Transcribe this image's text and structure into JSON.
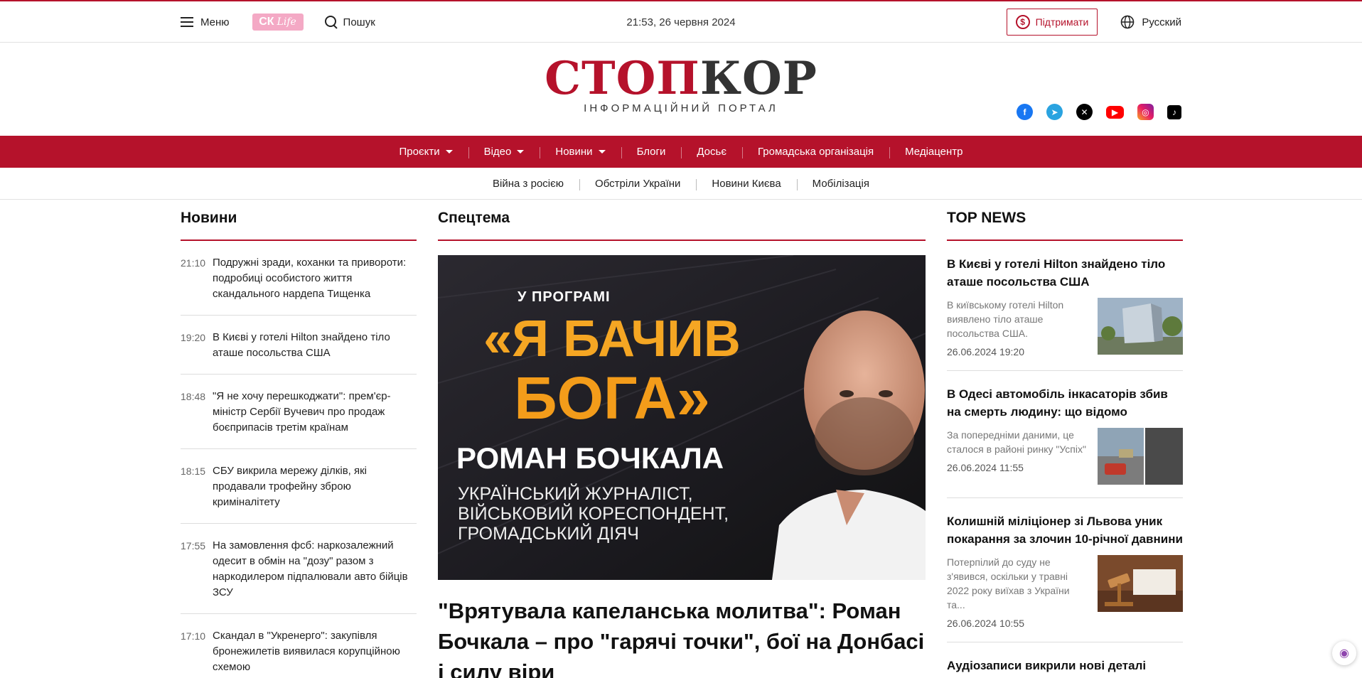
{
  "topbar": {
    "menu_label": "Меню",
    "cklife_main": "СК",
    "cklife_sub": "Life",
    "search_label": "Пошук",
    "datetime": "21:53, 26 червня 2024",
    "support_label": "Підтримати",
    "support_icon": "$",
    "language_label": "Русский"
  },
  "brand": {
    "logo_red": "СТОП",
    "logo_dark": "КОР",
    "tagline": "ІНФОРМАЦІЙНИЙ ПОРТАЛ"
  },
  "socials": [
    "facebook-icon",
    "telegram-icon",
    "x-icon",
    "youtube-icon",
    "instagram-icon",
    "tiktok-icon"
  ],
  "main_nav": [
    {
      "label": "Проєкти",
      "dropdown": true
    },
    {
      "label": "Відео",
      "dropdown": true
    },
    {
      "label": "Новини",
      "dropdown": true
    },
    {
      "label": "Блоги",
      "dropdown": false
    },
    {
      "label": "Досьє",
      "dropdown": false
    },
    {
      "label": "Громадська організація",
      "dropdown": false
    },
    {
      "label": "Медіацентр",
      "dropdown": false
    }
  ],
  "sub_nav": [
    "Війна з росією",
    "Обстріли України",
    "Новини Києва",
    "Мобілізація"
  ],
  "news": {
    "title": "Новини",
    "items": [
      {
        "time": "21:10",
        "headline": "Подружні зради, коханки та привороти: подробиці особистого життя скандального нардепа Тищенка"
      },
      {
        "time": "19:20",
        "headline": "В Києві у готелі Hilton знайдено тіло аташе посольства США"
      },
      {
        "time": "18:48",
        "headline": "\"Я не хочу перешкоджати\": прем'єр-міністр Сербії Вучевич про продаж боєприпасів третім країнам"
      },
      {
        "time": "18:15",
        "headline": "СБУ викрила мережу ділків, які продавали трофейну зброю криміналітету"
      },
      {
        "time": "17:55",
        "headline": "На замовлення фсб: наркозалежний одесит в обмін на \"дозу\" разом з наркодилером підпалювали авто бійців ЗСУ"
      },
      {
        "time": "17:10",
        "headline": "Скандал в \"Укренерго\": закупівля бронежилетів виявилася корупційною схемою"
      }
    ]
  },
  "special": {
    "title": "Спецтема",
    "hero_line1": "У ПРОГРАМІ",
    "hero_line2": "«Я БАЧИВ",
    "hero_line3": "БОГА»",
    "hero_line4": "РОМАН БОЧКАЛА",
    "hero_line5": "УКРАЇНСЬКИЙ ЖУРНАЛІСТ, ВІЙСЬКОВИЙ КОРЕСПОНДЕНТ, ГРОМАДСЬКИЙ ДІЯЧ",
    "headline": "\"Врятувала капеланська молитва\": Роман Бочкала – про \"гарячі точки\", бої на Донбасі і силу віри"
  },
  "top_news": {
    "title": "TOP NEWS",
    "items": [
      {
        "headline": "В Києві у готелі Hilton знайдено тіло аташе посольства США",
        "lead": "В київському готелі Hilton виявлено тіло аташе посольства США.",
        "date": "26.06.2024 19:20"
      },
      {
        "headline": "В Одесі автомобіль інкасаторів збив на смерть людину: що відомо",
        "lead": "За попередніми даними, це сталося в районі ринку \"Успіх\"",
        "date": "26.06.2024 11:55"
      },
      {
        "headline": "Колишній міліціонер зі Львова уник покарання за злочин 10-річної давнини",
        "lead": "Потерпілий до суду не з'явився, оскільки у травні 2022 року виїхав з України та...",
        "date": "26.06.2024 10:55"
      },
      {
        "headline": "Аудіозаписи викрили нові деталі",
        "lead": "",
        "date": ""
      }
    ]
  },
  "colors": {
    "brand_red": "#b5122b",
    "hero_orange": "#f39c1a"
  }
}
